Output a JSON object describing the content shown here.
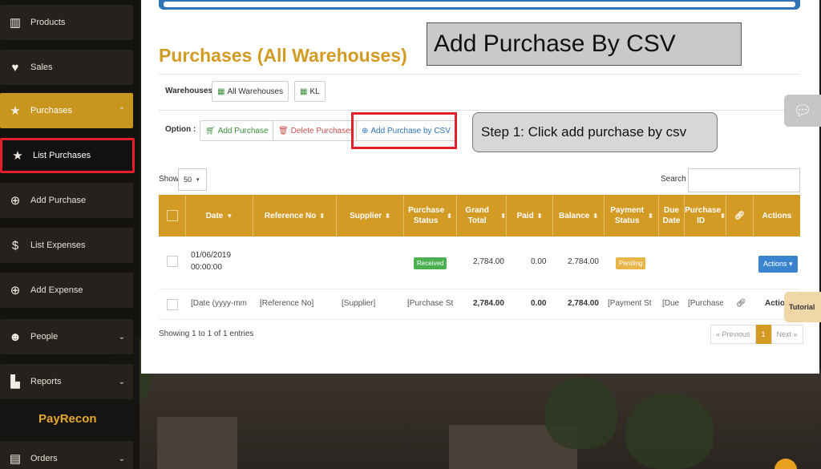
{
  "sidebar": {
    "items": [
      {
        "label": "Products",
        "icon": "barcode-icon"
      },
      {
        "label": "Sales",
        "icon": "heart-icon"
      },
      {
        "label": "Purchases",
        "icon": "star-icon"
      },
      {
        "label": "List Purchases",
        "icon": "star-icon"
      },
      {
        "label": "Add Purchase",
        "icon": "plus-circle-icon"
      },
      {
        "label": "List Expenses",
        "icon": "dollar-icon"
      },
      {
        "label": "Add Expense",
        "icon": "plus-circle-icon"
      },
      {
        "label": "People",
        "icon": "users-icon"
      },
      {
        "label": "Reports",
        "icon": "bar-chart-icon"
      },
      {
        "label": "Orders",
        "icon": "list-icon"
      }
    ],
    "brand": "PayRecon"
  },
  "page": {
    "title": "Purchases (All Warehouses)",
    "banner": "Add Purchase By CSV",
    "callout": "Step 1: Click add purchase by csv"
  },
  "warehouses": {
    "label": "Warehouses:",
    "all": "All Warehouses",
    "kl": "KL"
  },
  "options": {
    "label": "Option :",
    "add": "Add Purchase",
    "delete": "Delete Purchases",
    "csv": "Add Purchase by CSV"
  },
  "table_controls": {
    "show_label": "Show",
    "page_size": "50",
    "search_label": "Search"
  },
  "table": {
    "headers": [
      "Date",
      "Reference No",
      "Supplier",
      "Purchase Status",
      "Grand Total",
      "Paid",
      "Balance",
      "Payment Status",
      "Due Date",
      "Purchase ID",
      "Actions"
    ],
    "row": {
      "date": "01/06/2019",
      "time": "00:00:00",
      "status": "Received",
      "grand_total": "2,784.00",
      "paid": "0.00",
      "balance": "2,784.00",
      "payment_status": "Pending",
      "actions": "Actions"
    },
    "filter_row": {
      "date": "[Date (yyyy-mm",
      "reference": "[Reference No]",
      "supplier": "[Supplier]",
      "status": "[Purchase St",
      "grand_total": "2,784.00",
      "paid": "0.00",
      "balance": "2,784.00",
      "payment": "[Payment St",
      "due": "[Due",
      "purchase_id": "[Purchase",
      "actions": "Actions"
    }
  },
  "footer": {
    "info": "Showing 1 to 1 of 1 entries",
    "prev": "« Previous",
    "page": "1",
    "next": "Next »"
  },
  "side_tabs": {
    "tutorial": "Tutorial"
  },
  "colors": {
    "accent": "#d39a24",
    "sidebar_active": "#c8961e",
    "highlight": "#e0202a",
    "received": "#4caf50",
    "pending": "#e8b54a",
    "actions": "#3a84cf"
  }
}
